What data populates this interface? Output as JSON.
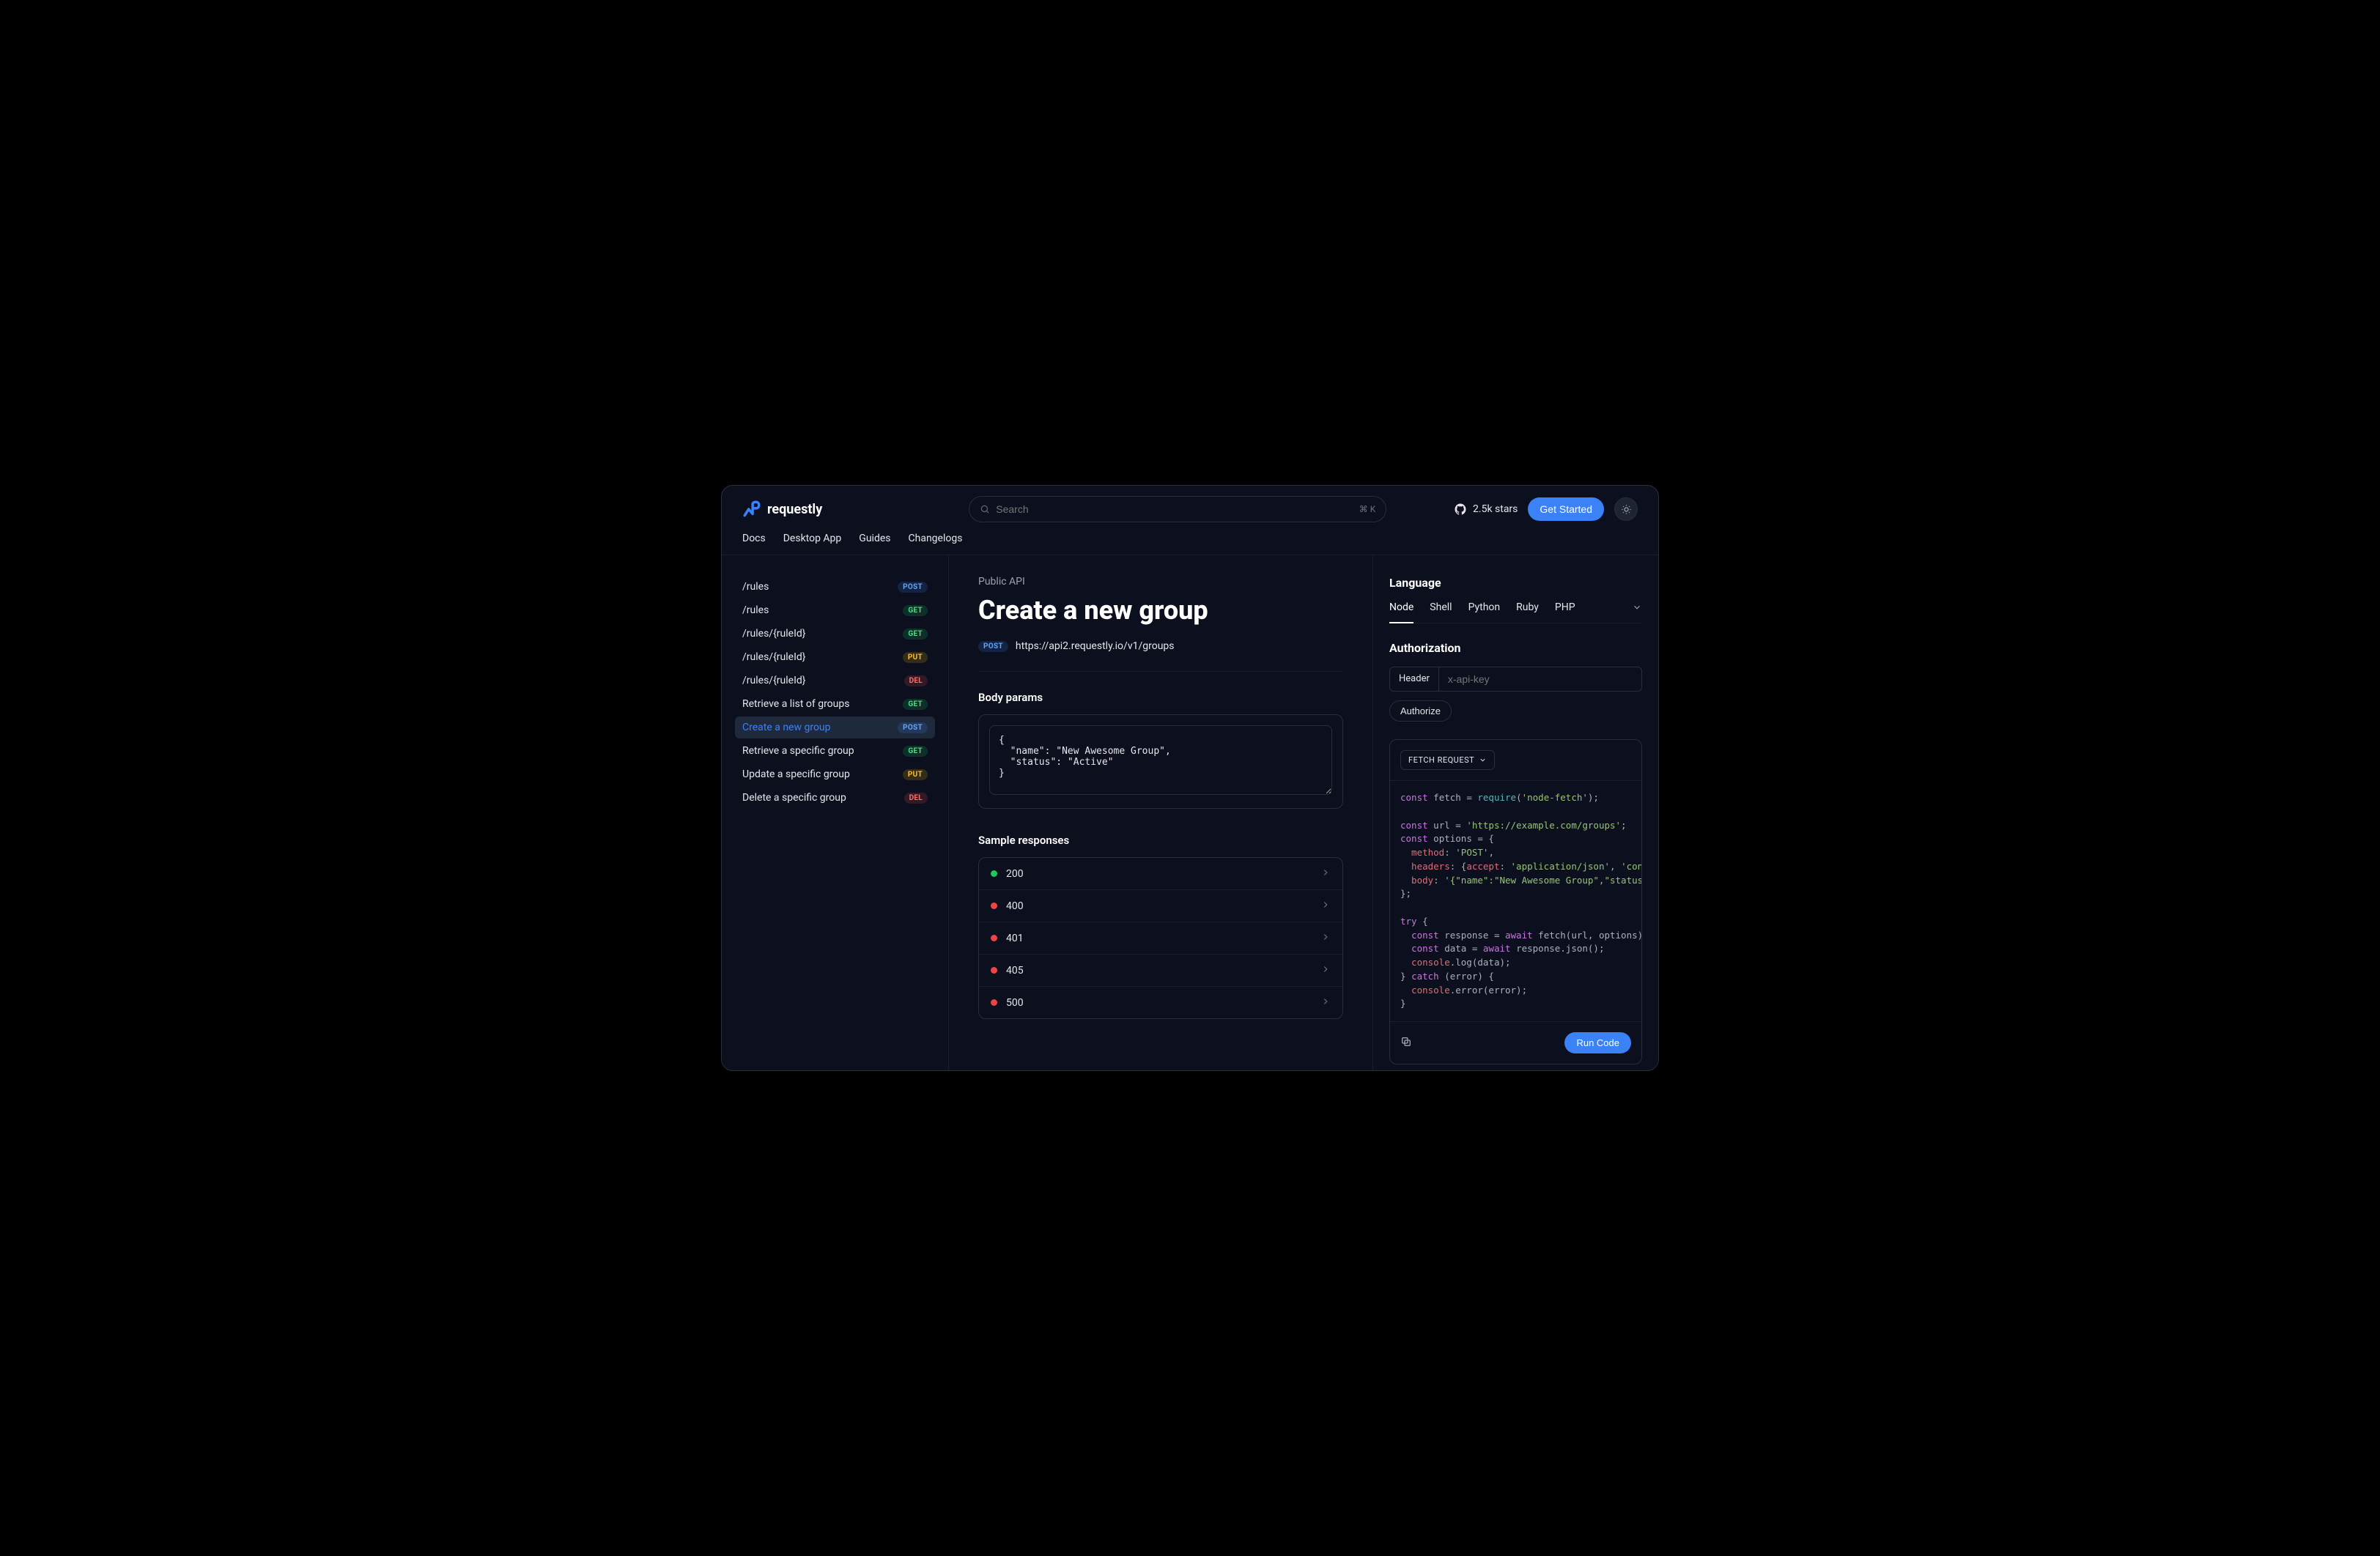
{
  "brand": {
    "name": "requestly"
  },
  "search": {
    "placeholder": "Search",
    "shortcut": "⌘ K"
  },
  "github": {
    "label": "2.5k stars"
  },
  "cta": {
    "label": "Get Started"
  },
  "nav": {
    "docs": "Docs",
    "desktop": "Desktop App",
    "guides": "Guides",
    "changelogs": "Changelogs"
  },
  "sidebar": [
    {
      "label": "/rules",
      "method": "POST"
    },
    {
      "label": "/rules",
      "method": "GET"
    },
    {
      "label": "/rules/{ruleId}",
      "method": "GET"
    },
    {
      "label": "/rules/{ruleId}",
      "method": "PUT"
    },
    {
      "label": "/rules/{ruleId}",
      "method": "DEL"
    },
    {
      "label": "Retrieve a list of groups",
      "method": "GET"
    },
    {
      "label": "Create a new group",
      "method": "POST",
      "active": true
    },
    {
      "label": "Retrieve a specific group",
      "method": "GET"
    },
    {
      "label": "Update a specific group",
      "method": "PUT"
    },
    {
      "label": "Delete a specific group",
      "method": "DEL"
    }
  ],
  "main": {
    "breadcrumb": "Public API",
    "title": "Create a new group",
    "method": "POST",
    "url": "https://api2.requestly.io/v1/groups",
    "body_params_title": "Body params",
    "body_params_value": "{\n  \"name\": \"New Awesome Group\",\n  \"status\": \"Active\"\n}",
    "sample_responses_title": "Sample responses",
    "responses": [
      {
        "code": "200",
        "status": "green"
      },
      {
        "code": "400",
        "status": "red"
      },
      {
        "code": "401",
        "status": "red"
      },
      {
        "code": "405",
        "status": "red"
      },
      {
        "code": "500",
        "status": "red"
      }
    ]
  },
  "right": {
    "language_title": "Language",
    "langs": [
      "Node",
      "Shell",
      "Python",
      "Ruby",
      "PHP"
    ],
    "auth_title": "Authorization",
    "auth_header_label": "Header",
    "auth_placeholder": "x-api-key",
    "authorize_label": "Authorize",
    "fetch_label": "FETCH REQUEST",
    "run_label": "Run Code",
    "code": {
      "l1_a": "const",
      "l1_b": " fetch = ",
      "l1_c": "require",
      "l1_d": "(",
      "l1_e": "'node-fetch'",
      "l1_f": ");",
      "l2_a": "const",
      "l2_b": " url = ",
      "l2_c": "'https://example.com/groups'",
      "l2_d": ";",
      "l3_a": "const",
      "l3_b": " options = {",
      "l4_a": "  method",
      "l4_b": ": ",
      "l4_c": "'POST'",
      "l4_d": ",",
      "l5_a": "  headers",
      "l5_b": ": {",
      "l5_c": "accept",
      "l5_d": ": ",
      "l5_e": "'application/json'",
      "l5_f": ", ",
      "l5_g": "'content",
      "l6_a": "  body",
      "l6_b": ": ",
      "l6_c": "'{\"name\":\"New Awesome Group\",\"status\":\"A",
      "l7": "};",
      "l8_a": "try",
      "l8_b": " {",
      "l9_a": "  const",
      "l9_b": " response = ",
      "l9_c": "await",
      "l9_d": " fetch(url, options);",
      "l10_a": "  const",
      "l10_b": " data = ",
      "l10_c": "await",
      "l10_d": " response.json();",
      "l11_a": "  console",
      "l11_b": ".log(data);",
      "l12_a": "} ",
      "l12_b": "catch",
      "l12_c": " (error) {",
      "l13_a": "  console",
      "l13_b": ".error(error);",
      "l14": "}"
    }
  }
}
